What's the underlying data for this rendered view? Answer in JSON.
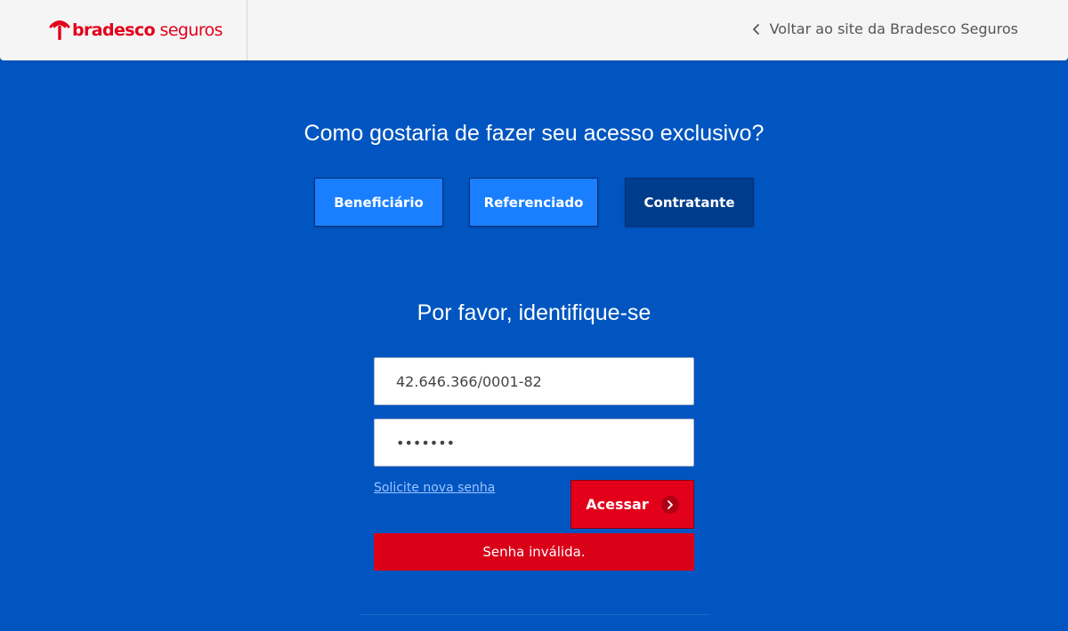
{
  "header": {
    "logo_bold": "bradesco",
    "logo_light": " seguros",
    "back_link": "Voltar ao site da Bradesco Seguros"
  },
  "access": {
    "question": "Como gostaria de fazer seu acesso exclusivo?",
    "roles": [
      "Beneficiário",
      "Referenciado",
      "Contratante"
    ],
    "selected": "Contratante"
  },
  "login": {
    "title": "Por favor, identifique-se",
    "cnpj_value": "42.646.366/0001-82",
    "password_display": "•••••••",
    "forgot_link": "Solicite nova senha",
    "submit_label": "Acessar",
    "error_message": "Senha inválida."
  },
  "colors": {
    "background": "#0055c0",
    "brand_red": "#e3001b",
    "role_default": "#1a7fff",
    "role_selected": "#003c8c"
  },
  "icons": [
    "bradesco-logo-icon",
    "chevron-left-icon",
    "chevron-right-icon"
  ]
}
